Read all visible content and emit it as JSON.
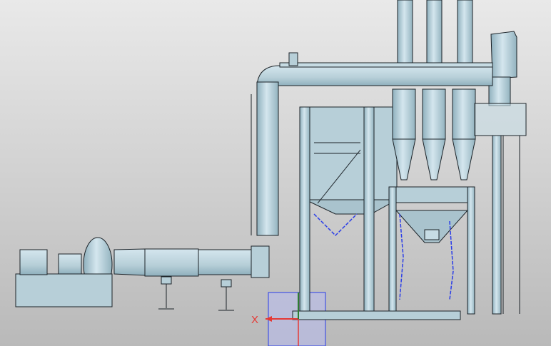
{
  "viewport": {
    "background_top": "#e9e9e9",
    "background_bottom": "#b9b9b9"
  },
  "colors": {
    "body": "#b7cfd8",
    "body_dark": "#8fb0bd",
    "body_light": "#d4e6ee",
    "edge": "#1c2328",
    "selection": "#2a3de8",
    "axis_x": "#e53935",
    "axis_y": "#2e7d32",
    "bbox_fill": "#b8bbf0"
  },
  "triad": {
    "x_label": "X"
  },
  "model": {
    "name_icon": "industrial-dust-collector-3d-model",
    "parts": [
      "fan-motor",
      "centrifugal-fan",
      "inlet-duct",
      "vertical-duct",
      "stacks",
      "cyclones",
      "baghouse",
      "ladders",
      "platform",
      "hopper"
    ]
  }
}
